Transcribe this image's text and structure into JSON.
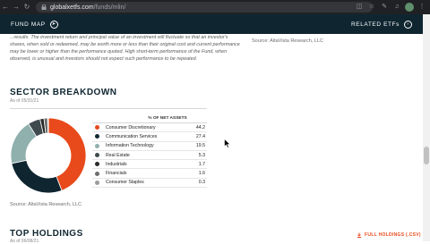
{
  "browser": {
    "url_host": "globalxetfs.com",
    "url_path": "/funds/mlin/"
  },
  "header": {
    "fund_map_label": "FUND MAP",
    "related_label": "RELATED ETFs"
  },
  "disclaimer": {
    "text": "...results. The investment return and principal value of an investment will fluctuate so that an investor's shares, when sold or redeemed, may be worth more or less than their original cost and current performance may be lower or higher than the performance quoted. High short-term performance of the Fund, when observed, is unusual and investors should not expect such performance to be repeated.",
    "source_right": "Source: AltaVista Research, LLC"
  },
  "sector": {
    "title": "SECTOR BREAKDOWN",
    "as_of": "As of 05/31/21",
    "table_header": "% OF NET ASSETS",
    "source": "Source: AltaVista Research, LLC",
    "rows": [
      {
        "name": "Consumer Discretionary",
        "value": "44.2",
        "color": "#e84a1b"
      },
      {
        "name": "Communication Services",
        "value": "27.4",
        "color": "#0f2631"
      },
      {
        "name": "Information Technology",
        "value": "19.5",
        "color": "#8fb0ad"
      },
      {
        "name": "Real Estate",
        "value": "5.3",
        "color": "#3f4a4f"
      },
      {
        "name": "Industrials",
        "value": "1.7",
        "color": "#2a2a2a"
      },
      {
        "name": "Financials",
        "value": "1.6",
        "color": "#6d6d6d"
      },
      {
        "name": "Consumer Staples",
        "value": "0.3",
        "color": "#9a9a9a"
      }
    ]
  },
  "holdings": {
    "title": "TOP HOLDINGS",
    "as_of": "As of 06/08/21",
    "full_link": "FULL HOLDINGS (.CSV)"
  }
}
